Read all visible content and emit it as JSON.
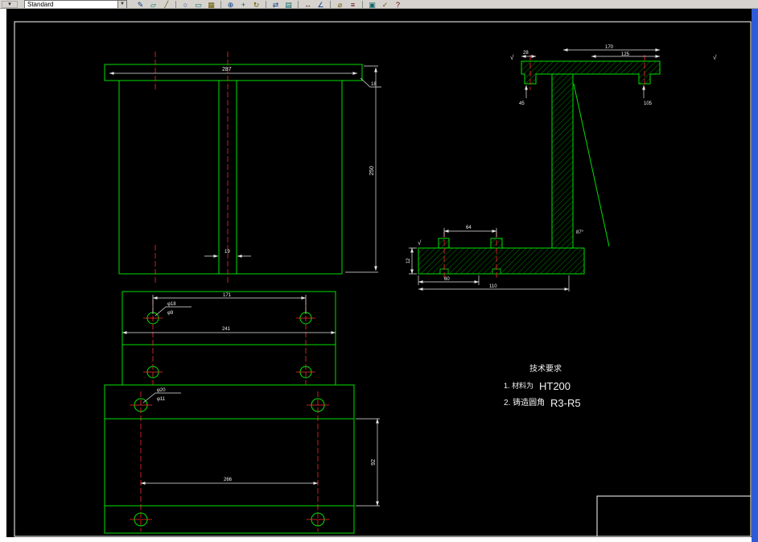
{
  "toolbar": {
    "style_value": "Standard",
    "dropdown_arrow": "▼",
    "corner_glyph": "▾",
    "icons": [
      {
        "name": "sketch-icon",
        "glyph": "✎"
      },
      {
        "name": "erase-icon",
        "glyph": "▱"
      },
      {
        "name": "line-icon",
        "glyph": "╱"
      },
      {
        "name": "circle-icon",
        "glyph": "○"
      },
      {
        "name": "rectangle-icon",
        "glyph": "▭"
      },
      {
        "name": "grid-icon",
        "glyph": "▦"
      },
      {
        "name": "snap-icon",
        "glyph": "⊕"
      },
      {
        "name": "move-icon",
        "glyph": "+"
      },
      {
        "name": "rotate-icon",
        "glyph": "↻"
      },
      {
        "name": "mirror-icon",
        "glyph": "⇄"
      },
      {
        "name": "array-icon",
        "glyph": "▤"
      },
      {
        "name": "dimension-icon",
        "glyph": "↔"
      },
      {
        "name": "angle-icon",
        "glyph": "∠"
      },
      {
        "name": "diameter-icon",
        "glyph": "⌀"
      },
      {
        "name": "layers-icon",
        "glyph": "≡"
      },
      {
        "name": "match-icon",
        "glyph": "▣"
      },
      {
        "name": "check-icon",
        "glyph": "✓"
      },
      {
        "name": "help-icon",
        "glyph": "?"
      }
    ]
  },
  "drawing": {
    "colors": {
      "line": "#00e000",
      "centerline": "#ff2a2a",
      "dimension": "#ffffff",
      "background": "#000000"
    },
    "roughness": "√",
    "tech": {
      "title": "技术要求",
      "item1_prefix": "1. 材料为",
      "item1_value": "HT200",
      "item2_prefix": "2. 铸造圆角",
      "item2_value": "R3-R5"
    },
    "dims": {
      "front_width": "287",
      "front_height": "250",
      "front_slot": "19",
      "front_leader": "18",
      "sec_top_outer": "170",
      "sec_top_inner": "125",
      "sec_left_top": "28",
      "sec_left_thk": "45",
      "sec_right_thk": "105",
      "sec_mid": "64",
      "sec_base_h": "12",
      "sec_bot_inner": "60",
      "sec_bot_outer": "110",
      "sec_angle": "87°",
      "plan_span": "171",
      "plan_width": "241",
      "plan_dia1": "φ18",
      "plan_dia2": "φ9",
      "base_span": "266",
      "base_h": "92",
      "base_dia1": "φ20",
      "base_dia2": "φ11"
    }
  }
}
